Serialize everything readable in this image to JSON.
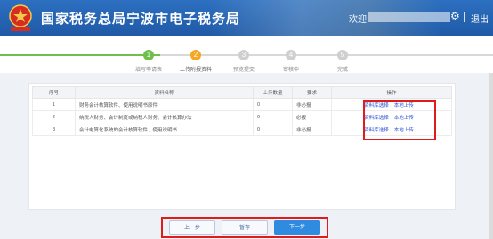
{
  "header": {
    "title": "国家税务总局宁波市电子税务局",
    "welcome": "欢迎",
    "logout": "退出",
    "colors": {
      "bar": "#1f5aa6"
    }
  },
  "steps": [
    {
      "num": "1",
      "label": "填写申请表",
      "state": "done"
    },
    {
      "num": "2",
      "label": "上传附报资料",
      "state": "current"
    },
    {
      "num": "3",
      "label": "预览提交",
      "state": "todo"
    },
    {
      "num": "4",
      "label": "审核中",
      "state": "todo"
    },
    {
      "num": "5",
      "label": "完成",
      "state": "todo"
    }
  ],
  "table": {
    "headers": [
      "序号",
      "资料名称",
      "上传数量",
      "要求",
      "操作"
    ],
    "rows": [
      {
        "no": "1",
        "name": "财务会计核算软件、使用说明书原件",
        "count": "0",
        "req": "非必报",
        "op1": "资料库选择",
        "op2": "本地上传"
      },
      {
        "no": "2",
        "name": "纳税人财务、会计制度或纳税人财务、会计核算办法",
        "count": "0",
        "req": "必报",
        "op1": "资料库选择",
        "op2": "本地上传"
      },
      {
        "no": "3",
        "name": "会计电算化系统的会计核算软件、使用说明书",
        "count": "0",
        "req": "非必报",
        "op1": "资料库选择",
        "op2": "本地上传"
      }
    ]
  },
  "buttons": {
    "prev": "上一步",
    "save": "暂存",
    "next": "下一步"
  },
  "status_colors": {
    "done": "#6fbf4a",
    "current": "#f5a623",
    "todo": "#cfcfcf",
    "highlight": "#e11a1a"
  }
}
